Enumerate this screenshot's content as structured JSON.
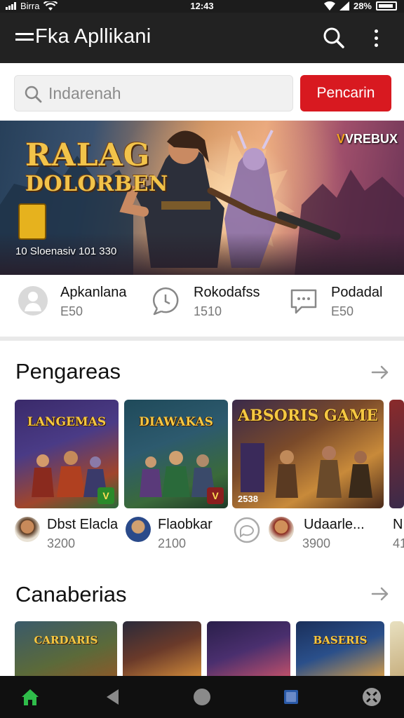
{
  "status_bar": {
    "carrier": "Birra",
    "time": "12:43",
    "battery": "28%"
  },
  "app_bar": {
    "title": "Fka Apllikani"
  },
  "search": {
    "placeholder": "Indarenah",
    "button_label": "Pencarin"
  },
  "banner": {
    "title_line1": "RALAG",
    "title_line2": "DOLORBEN",
    "meta": "10 Sloenasiv   101   330",
    "brand": "VREBUX"
  },
  "stats": [
    {
      "name": "Apkanlana",
      "value": "E50",
      "icon": "user-icon"
    },
    {
      "name": "Rokodafss",
      "value": "1510",
      "icon": "chat-refresh-icon"
    },
    {
      "name": "Podadal",
      "value": "E50",
      "icon": "chat-bubble-icon"
    }
  ],
  "sections": [
    {
      "title": "Pengareas"
    },
    {
      "title": "Canaberias"
    }
  ],
  "featured_apps": [
    {
      "card_title": "LANGEMAS",
      "name": "Dbst Elacla",
      "count": "3200",
      "color": "#4a3b86"
    },
    {
      "card_title": "DIAWAKAS",
      "name": "Flaobkar",
      "count": "2100",
      "color": "#2d5a6e"
    },
    {
      "card_title": "ABSORIS GAME",
      "card_count": "2538",
      "name": "Udaarle...",
      "count": "3900",
      "color": "#7a4a2a"
    },
    {
      "name": "N",
      "count": "41"
    }
  ],
  "second_row": [
    {
      "card_title": "CARDARIS",
      "color": "#5b6a3a"
    },
    {
      "card_title": "",
      "color": "#6a3a2a"
    },
    {
      "card_title": "",
      "color": "#4a2f6e"
    },
    {
      "card_title": "BASERIS",
      "color": "#2a4f8a"
    }
  ],
  "colors": {
    "accent": "#d81920",
    "app_bar": "#222222",
    "nav_bar": "#101010",
    "home_active": "#2fbd4a"
  }
}
